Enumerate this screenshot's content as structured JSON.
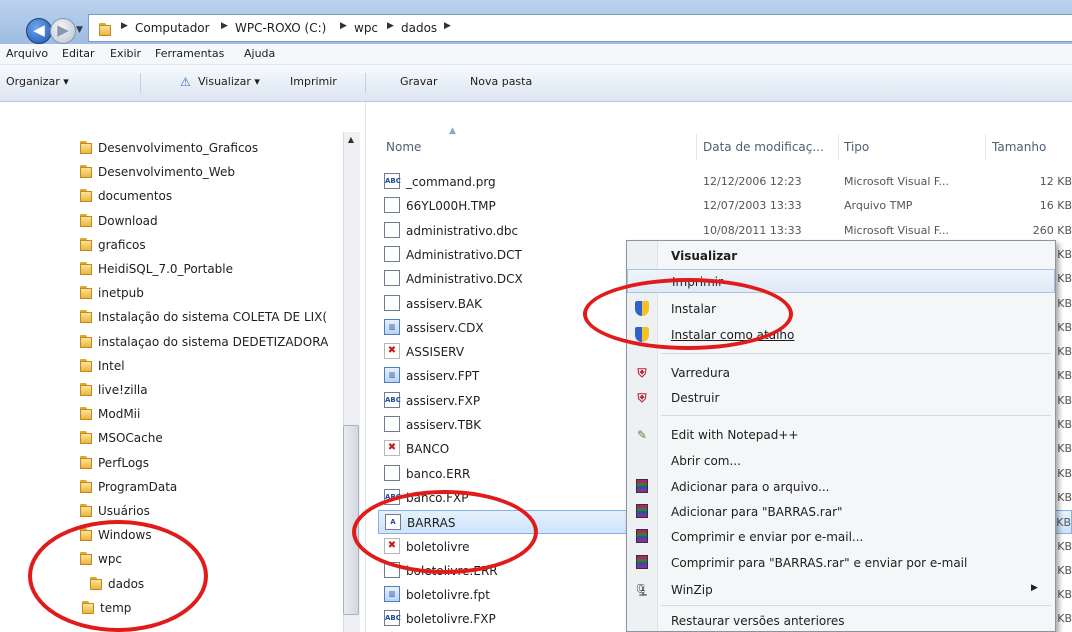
{
  "address": {
    "crumbs": [
      "Computador",
      "WPC-ROXO (C:)",
      "wpc",
      "dados"
    ]
  },
  "menu": [
    "Arquivo",
    "Editar",
    "Exibir",
    "Ferramentas",
    "Ajuda"
  ],
  "toolbar": {
    "organize": "Organizar ▾",
    "view": "Visualizar ▾",
    "print": "Imprimir",
    "burn": "Gravar",
    "new_folder": "Nova pasta"
  },
  "nav": [
    "Desenvolvimento_Graficos",
    "Desenvolvimento_Web",
    "documentos",
    "Download",
    "graficos",
    "HeidiSQL_7.0_Portable",
    "inetpub",
    "Instalação do sistema COLETA DE LIX(",
    "instalaçao do sistema DEDETIZADORA",
    "Intel",
    "live!zilla",
    "ModMii",
    "MSOCache",
    "PerfLogs",
    "ProgramData",
    "Usuários",
    "Windows",
    "wpc",
    "dados",
    "temp"
  ],
  "columns": {
    "name": "Nome",
    "date": "Data de modificaç...",
    "type": "Tipo",
    "size": "Tamanho"
  },
  "files": [
    {
      "name": "_command.prg",
      "date": "12/12/2006 12:23",
      "type": "Microsoft Visual F...",
      "size": "12 KB",
      "icon": "ABC"
    },
    {
      "name": "66YL000H.TMP",
      "date": "12/07/2003 13:33",
      "type": "Arquivo TMP",
      "size": "16 KB",
      "icon": ""
    },
    {
      "name": "administrativo.dbc",
      "date": "10/08/2011 13:33",
      "type": "Microsoft Visual F...",
      "size": "260 KB",
      "icon": ""
    },
    {
      "name": "Administrativo.DCT",
      "size": "KB",
      "icon": ""
    },
    {
      "name": "Administrativo.DCX",
      "size": "KB",
      "icon": ""
    },
    {
      "name": "assiserv.BAK",
      "size": "KB",
      "icon": ""
    },
    {
      "name": "assiserv.CDX",
      "size": "KB",
      "icon": "▥"
    },
    {
      "name": "ASSISERV",
      "size": "KB",
      "icon": "✖"
    },
    {
      "name": "assiserv.FPT",
      "size": "KB",
      "icon": "▥"
    },
    {
      "name": "assiserv.FXP",
      "size": "KB",
      "icon": "ABC"
    },
    {
      "name": "assiserv.TBK",
      "size": "KB",
      "icon": ""
    },
    {
      "name": "BANCO",
      "size": "KB",
      "icon": "✖"
    },
    {
      "name": "banco.ERR",
      "size": "KB",
      "icon": ""
    },
    {
      "name": "banco.FXP",
      "size": "KB",
      "icon": "ABC"
    },
    {
      "name": "BARRAS",
      "size": "KB",
      "icon": "A"
    },
    {
      "name": "boletolivre",
      "size": "KB",
      "icon": "✖"
    },
    {
      "name": "boletolivre.ERR",
      "size": "KB",
      "icon": ""
    },
    {
      "name": "boletolivre.fpt",
      "size": "KB",
      "icon": "▥"
    },
    {
      "name": "boletolivre.FXP",
      "size": "KB",
      "icon": "ABC"
    }
  ],
  "context_menu": {
    "open": "Visualizar",
    "print": "Imprimir",
    "install": "Instalar",
    "install_shortcut": "Instalar como atalho",
    "scan": "Varredura",
    "destroy": "Destruir",
    "notepad": "Edit with Notepad++",
    "open_with": "Abrir com...",
    "add_archive": "Adicionar para o arquivo...",
    "add_rar": "Adicionar para \"BARRAS.rar\"",
    "compress_email": "Comprimir e enviar por e-mail...",
    "compress_rar_email": "Comprimir para \"BARRAS.rar\" e enviar por e-mail",
    "winzip": "WinZip",
    "restore": "Restaurar versões anteriores"
  },
  "annotation_color": "#e11a1a"
}
